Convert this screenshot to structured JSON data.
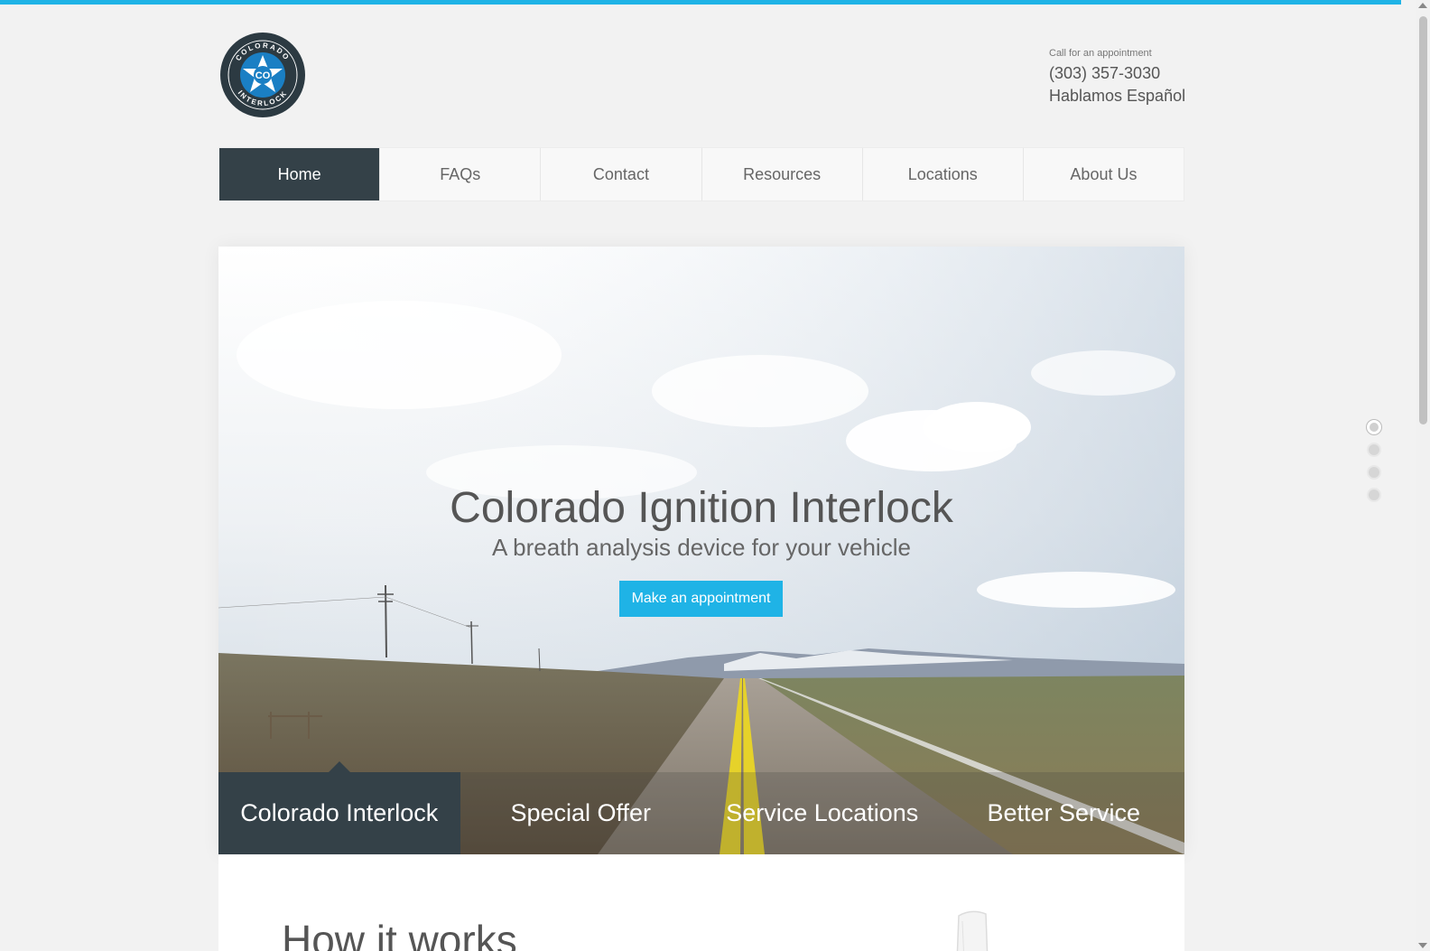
{
  "header": {
    "logo_icon": "colorado-interlock-logo",
    "logo_top_text": "COLORADO",
    "logo_center_text": "CO",
    "logo_bottom_text": "INTERLOCK",
    "call_label": "Call for an appointment",
    "phone": "(303) 357-3030",
    "language_note": "Hablamos Español"
  },
  "nav": {
    "items": [
      {
        "label": "Home",
        "active": true
      },
      {
        "label": "FAQs"
      },
      {
        "label": "Contact"
      },
      {
        "label": "Resources"
      },
      {
        "label": "Locations"
      },
      {
        "label": "About Us"
      }
    ]
  },
  "hero": {
    "title": "Colorado Ignition Interlock",
    "subtitle": "A breath analysis device for your vehicle",
    "button_label": "Make an appointment",
    "tabs": [
      {
        "label": "Colorado Interlock",
        "active": true
      },
      {
        "label": "Special Offer"
      },
      {
        "label": "Service Locations"
      },
      {
        "label": "Better Service"
      }
    ]
  },
  "section": {
    "heading": "How it works"
  },
  "colors": {
    "accent": "#1fb3e6",
    "nav_active": "#344148",
    "background": "#f2f2f2"
  }
}
